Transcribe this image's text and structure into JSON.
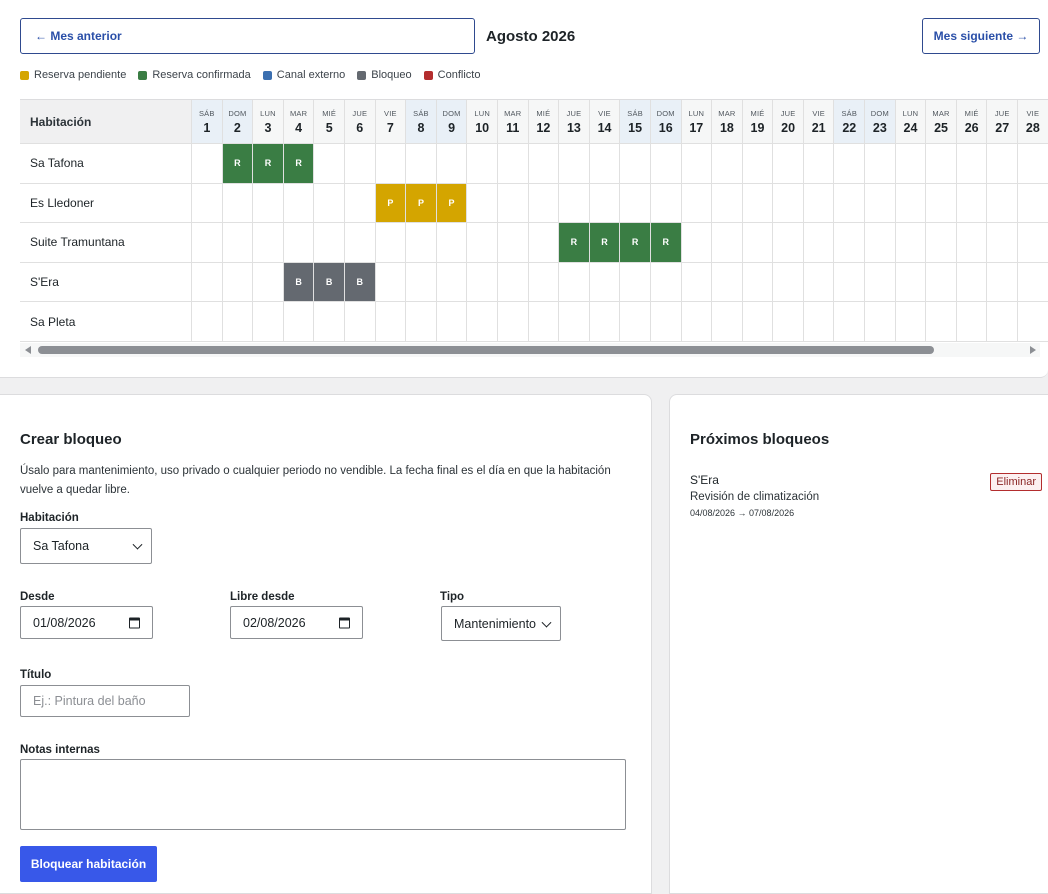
{
  "calendar": {
    "prev_label": "← Mes anterior",
    "next_label": "Mes siguiente →",
    "month_title": "Agosto 2026",
    "legend": [
      {
        "label": "Reserva pendiente",
        "color": "#d4a500"
      },
      {
        "label": "Reserva confirmada",
        "color": "#3a7d44"
      },
      {
        "label": "Canal externo",
        "color": "#3b6fb0"
      },
      {
        "label": "Bloqueo",
        "color": "#646970"
      },
      {
        "label": "Conflicto",
        "color": "#b32d2e"
      }
    ],
    "room_header": "Habitación",
    "days": [
      {
        "dow": "SÁB",
        "num": "1"
      },
      {
        "dow": "DOM",
        "num": "2"
      },
      {
        "dow": "LUN",
        "num": "3"
      },
      {
        "dow": "MAR",
        "num": "4"
      },
      {
        "dow": "MIÉ",
        "num": "5"
      },
      {
        "dow": "JUE",
        "num": "6"
      },
      {
        "dow": "VIE",
        "num": "7"
      },
      {
        "dow": "SÁB",
        "num": "8"
      },
      {
        "dow": "DOM",
        "num": "9"
      },
      {
        "dow": "LUN",
        "num": "10"
      },
      {
        "dow": "MAR",
        "num": "11"
      },
      {
        "dow": "MIÉ",
        "num": "12"
      },
      {
        "dow": "JUE",
        "num": "13"
      },
      {
        "dow": "VIE",
        "num": "14"
      },
      {
        "dow": "SÁB",
        "num": "15"
      },
      {
        "dow": "DOM",
        "num": "16"
      },
      {
        "dow": "LUN",
        "num": "17"
      },
      {
        "dow": "MAR",
        "num": "18"
      },
      {
        "dow": "MIÉ",
        "num": "19"
      },
      {
        "dow": "JUE",
        "num": "20"
      },
      {
        "dow": "VIE",
        "num": "21"
      },
      {
        "dow": "SÁB",
        "num": "22"
      },
      {
        "dow": "DOM",
        "num": "23"
      },
      {
        "dow": "LUN",
        "num": "24"
      },
      {
        "dow": "MAR",
        "num": "25"
      },
      {
        "dow": "MIÉ",
        "num": "26"
      },
      {
        "dow": "JUE",
        "num": "27"
      },
      {
        "dow": "VIE",
        "num": "28"
      }
    ],
    "rooms": [
      {
        "name": "Sa Tafona",
        "marks": [
          {
            "day": 2,
            "code": "R",
            "color": "#3a7d44"
          },
          {
            "day": 3,
            "code": "R",
            "color": "#3a7d44"
          },
          {
            "day": 4,
            "code": "R",
            "color": "#3a7d44"
          }
        ]
      },
      {
        "name": "Es Lledoner",
        "marks": [
          {
            "day": 7,
            "code": "P",
            "color": "#d4a500"
          },
          {
            "day": 8,
            "code": "P",
            "color": "#d4a500"
          },
          {
            "day": 9,
            "code": "P",
            "color": "#d4a500"
          }
        ]
      },
      {
        "name": "Suite Tramuntana",
        "marks": [
          {
            "day": 13,
            "code": "R",
            "color": "#3a7d44"
          },
          {
            "day": 14,
            "code": "R",
            "color": "#3a7d44"
          },
          {
            "day": 15,
            "code": "R",
            "color": "#3a7d44"
          },
          {
            "day": 16,
            "code": "R",
            "color": "#3a7d44"
          }
        ]
      },
      {
        "name": "S'Era",
        "marks": [
          {
            "day": 4,
            "code": "B",
            "color": "#646970"
          },
          {
            "day": 5,
            "code": "B",
            "color": "#646970"
          },
          {
            "day": 6,
            "code": "B",
            "color": "#646970"
          }
        ]
      },
      {
        "name": "Sa Pleta",
        "marks": []
      }
    ]
  },
  "block_form": {
    "title": "Crear bloqueo",
    "description": "Úsalo para mantenimiento, uso privado o cualquier periodo no vendible. La fecha final es el día en que la habitación vuelve a quedar libre.",
    "room_label": "Habitación",
    "room_value": "Sa Tafona",
    "from_label": "Desde",
    "from_value": "01/08/2026",
    "free_label": "Libre desde",
    "free_value": "02/08/2026",
    "type_label": "Tipo",
    "type_value": "Mantenimiento",
    "title_label": "Título",
    "title_placeholder": "Ej.: Pintura del baño",
    "notes_label": "Notas internas",
    "submit_label": "Bloquear habitación"
  },
  "upcoming": {
    "title": "Próximos bloqueos",
    "items": [
      {
        "room": "S'Era",
        "description": "Revisión de climatización",
        "dates": "04/08/2026 → 07/08/2026",
        "delete_label": "Eliminar"
      }
    ]
  }
}
